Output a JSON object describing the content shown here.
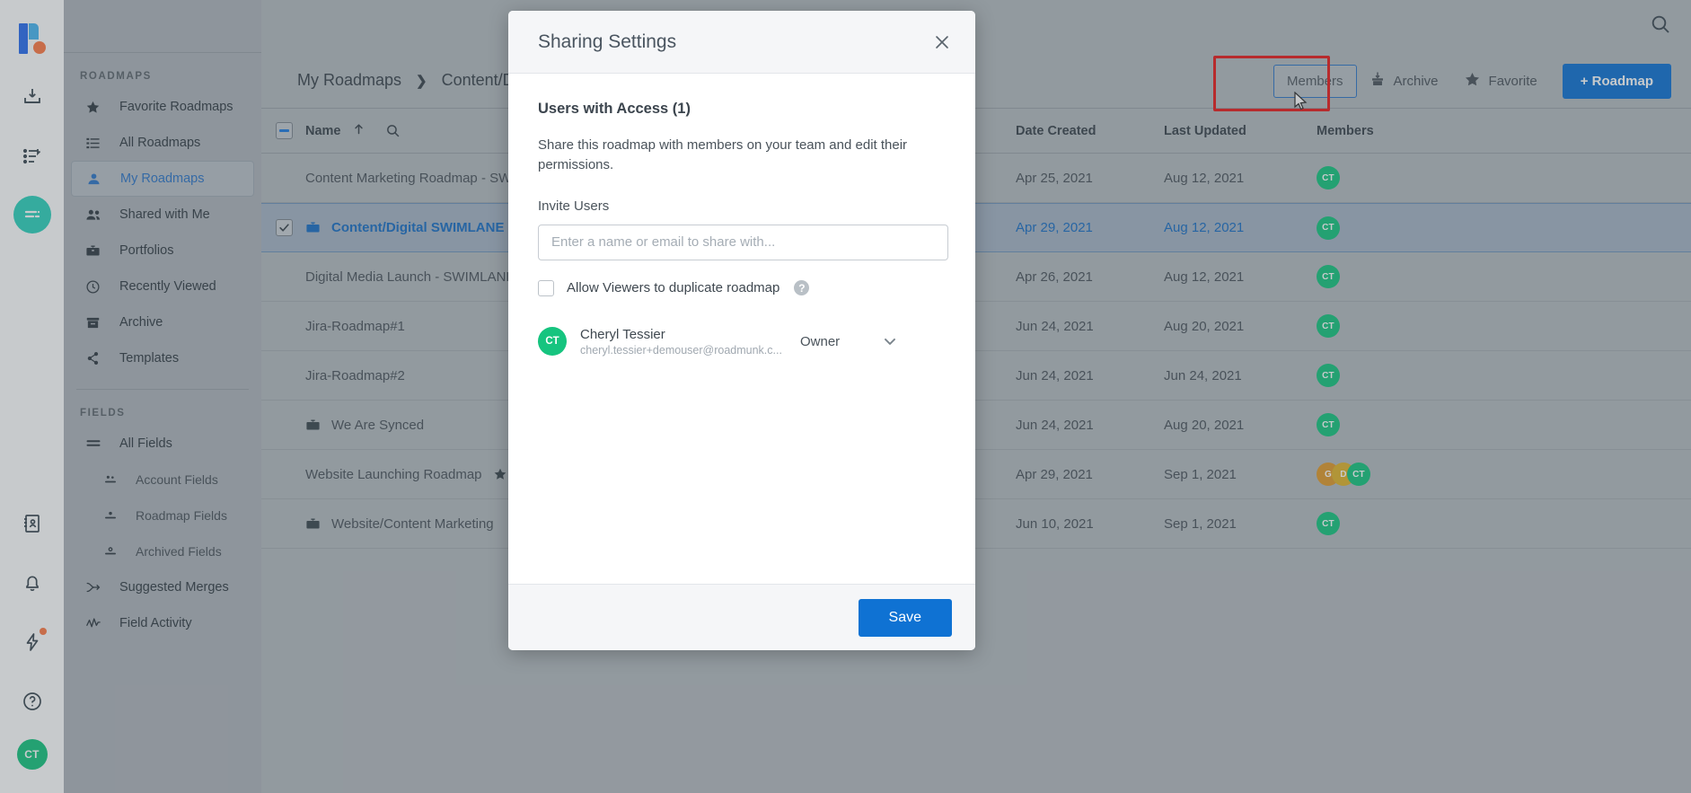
{
  "rail": {
    "logo": "roadmunk-logo",
    "icons": [
      {
        "name": "inbox-download-icon"
      },
      {
        "name": "list-undo-icon"
      },
      {
        "name": "feed-active-icon"
      },
      {
        "name": "contacts-book-icon"
      },
      {
        "name": "bell-icon"
      },
      {
        "name": "bolt-icon"
      },
      {
        "name": "help-circle-icon"
      }
    ],
    "avatar_initials": "CT"
  },
  "sidebar": {
    "sections": [
      {
        "title": "ROADMAPS",
        "items": [
          {
            "label": "Favorite Roadmaps",
            "icon": "star-icon",
            "selected": false,
            "sub": false
          },
          {
            "label": "All Roadmaps",
            "icon": "list-icon",
            "selected": false,
            "sub": false
          },
          {
            "label": "My Roadmaps",
            "icon": "person-icon",
            "selected": true,
            "sub": false
          },
          {
            "label": "Shared with Me",
            "icon": "people-icon",
            "selected": false,
            "sub": false
          },
          {
            "label": "Portfolios",
            "icon": "briefcase-icon",
            "selected": false,
            "sub": false
          },
          {
            "label": "Recently Viewed",
            "icon": "clock-icon",
            "selected": false,
            "sub": false
          },
          {
            "label": "Archive",
            "icon": "archive-icon",
            "selected": false,
            "sub": false
          },
          {
            "label": "Templates",
            "icon": "template-icon",
            "selected": false,
            "sub": false
          }
        ]
      },
      {
        "title": "FIELDS",
        "items": [
          {
            "label": "All Fields",
            "icon": "lines-icon",
            "selected": false,
            "sub": false
          },
          {
            "label": "Account Fields",
            "icon": "account-fields-icon",
            "selected": false,
            "sub": true
          },
          {
            "label": "Roadmap Fields",
            "icon": "roadmap-fields-icon",
            "selected": false,
            "sub": true
          },
          {
            "label": "Archived Fields",
            "icon": "archived-fields-icon",
            "selected": false,
            "sub": true
          },
          {
            "label": "Suggested Merges",
            "icon": "merge-icon",
            "selected": false,
            "sub": false
          },
          {
            "label": "Field Activity",
            "icon": "activity-icon",
            "selected": false,
            "sub": false
          }
        ]
      }
    ]
  },
  "topbar": {
    "search_icon": "search-icon"
  },
  "breadcrumb": {
    "root": "My Roadmaps",
    "separator": "❯",
    "current": "Content/Di..."
  },
  "actions": {
    "members": {
      "label": "Members",
      "icon": "",
      "focused": true
    },
    "archive": {
      "label": "Archive",
      "icon": "archive-icon"
    },
    "favorite": {
      "label": "Favorite",
      "icon": "star-icon"
    },
    "new_roadmap": {
      "label": "+ Roadmap"
    }
  },
  "table": {
    "headers": {
      "name": "Name",
      "date_created": "Date Created",
      "last_updated": "Last Updated",
      "members": "Members"
    },
    "rows": [
      {
        "name": "Content Marketing Roadmap - SW...",
        "date_created": "Apr 25, 2021",
        "last_updated": "Aug 12, 2021",
        "selected": false,
        "checked": false,
        "has_case_icon": false,
        "indent": false,
        "favorite": false,
        "avatars": [
          {
            "initials": "CT",
            "color": "#16c47f"
          }
        ]
      },
      {
        "name": "Content/Digital SWIMLANE",
        "date_created": "Apr 29, 2021",
        "last_updated": "Aug 12, 2021",
        "selected": true,
        "checked": true,
        "has_case_icon": true,
        "indent": false,
        "favorite": false,
        "avatars": [
          {
            "initials": "CT",
            "color": "#16c47f"
          }
        ]
      },
      {
        "name": "Digital Media Launch - SWIMLANE...",
        "date_created": "Apr 26, 2021",
        "last_updated": "Aug 12, 2021",
        "selected": false,
        "checked": false,
        "has_case_icon": false,
        "indent": false,
        "favorite": false,
        "avatars": [
          {
            "initials": "CT",
            "color": "#16c47f"
          }
        ]
      },
      {
        "name": "Jira-Roadmap#1",
        "date_created": "Jun 24, 2021",
        "last_updated": "Aug 20, 2021",
        "selected": false,
        "checked": false,
        "has_case_icon": false,
        "indent": false,
        "favorite": false,
        "avatars": [
          {
            "initials": "CT",
            "color": "#16c47f"
          }
        ]
      },
      {
        "name": "Jira-Roadmap#2",
        "date_created": "Jun 24, 2021",
        "last_updated": "Jun 24, 2021",
        "selected": false,
        "checked": false,
        "has_case_icon": false,
        "indent": false,
        "favorite": false,
        "avatars": [
          {
            "initials": "CT",
            "color": "#16c47f"
          }
        ]
      },
      {
        "name": "We Are Synced",
        "date_created": "Jun 24, 2021",
        "last_updated": "Aug 20, 2021",
        "selected": false,
        "checked": false,
        "has_case_icon": true,
        "indent": false,
        "favorite": false,
        "avatars": [
          {
            "initials": "CT",
            "color": "#16c47f"
          }
        ]
      },
      {
        "name": "Website Launching Roadmap",
        "date_created": "Apr 29, 2021",
        "last_updated": "Sep 1, 2021",
        "selected": false,
        "checked": false,
        "has_case_icon": false,
        "indent": false,
        "favorite": true,
        "avatars": [
          {
            "initials": "G",
            "color": "#e09a2b"
          },
          {
            "initials": "D",
            "color": "#e0b32b"
          },
          {
            "initials": "CT",
            "color": "#16c47f"
          }
        ]
      },
      {
        "name": "Website/Content Marketing",
        "date_created": "Jun 10, 2021",
        "last_updated": "Sep 1, 2021",
        "selected": false,
        "checked": false,
        "has_case_icon": true,
        "indent": false,
        "favorite": false,
        "avatars": [
          {
            "initials": "CT",
            "color": "#16c47f"
          }
        ]
      }
    ]
  },
  "modal": {
    "title": "Sharing Settings",
    "close_icon": "close-icon",
    "heading": "Users with Access (1)",
    "description": "Share this roadmap with members on your team and edit their permissions.",
    "invite_label": "Invite Users",
    "invite_placeholder": "Enter a name or email to share with...",
    "invite_value": "",
    "allow_duplicate_label": "Allow Viewers to duplicate roadmap",
    "allow_duplicate_checked": false,
    "help_icon_glyph": "?",
    "user": {
      "initials": "CT",
      "name": "Cheryl Tessier",
      "email": "cheryl.tessier+demouser@roadmunk.c...",
      "role": "Owner",
      "avatar_color": "#16c47f"
    },
    "save_label": "Save"
  },
  "colors": {
    "accent_blue": "#0f72d3",
    "link_blue": "#1b6fc4",
    "green_avatar": "#16c47f",
    "teal_rail": "#2ed3bd",
    "highlight_red": "#e81c1c"
  }
}
